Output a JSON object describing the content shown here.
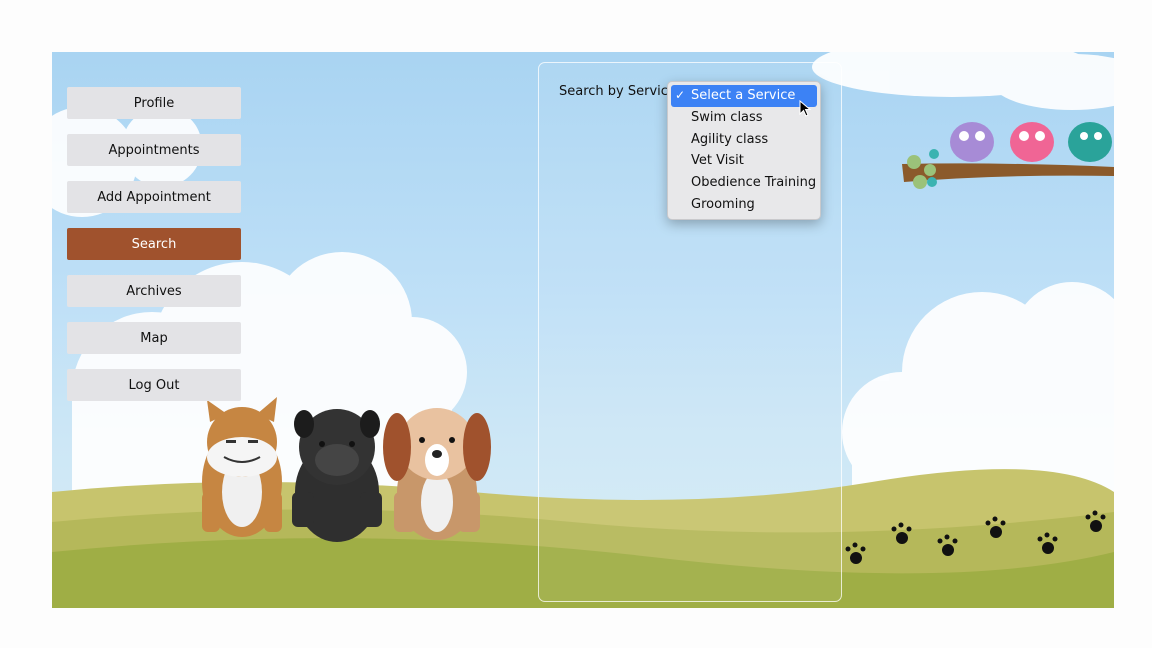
{
  "nav": {
    "items": [
      {
        "label": "Profile",
        "active": false
      },
      {
        "label": "Appointments",
        "active": false
      },
      {
        "label": "Add Appointment",
        "active": false
      },
      {
        "label": "Search",
        "active": true
      },
      {
        "label": "Archives",
        "active": false
      },
      {
        "label": "Map",
        "active": false
      },
      {
        "label": "Log Out",
        "active": false
      }
    ]
  },
  "search": {
    "label": "Search by Service:",
    "selected_index": 0,
    "options": [
      "Select a Service",
      "Swim class",
      "Agility class",
      "Vet Visit",
      "Obedience Training",
      "Grooming"
    ]
  },
  "colors": {
    "active_nav": "#a0522d",
    "nav_button": "#e3e3e6",
    "dropdown_highlight": "#3c82f5",
    "sky": "#bfe0f7",
    "grass": "#a3b34a"
  },
  "illustrations": [
    "shiba-dog",
    "pug-dog",
    "beagle-dog",
    "purple-bird",
    "pink-bird",
    "teal-bird",
    "paw-prints",
    "clouds",
    "tree-branch"
  ]
}
